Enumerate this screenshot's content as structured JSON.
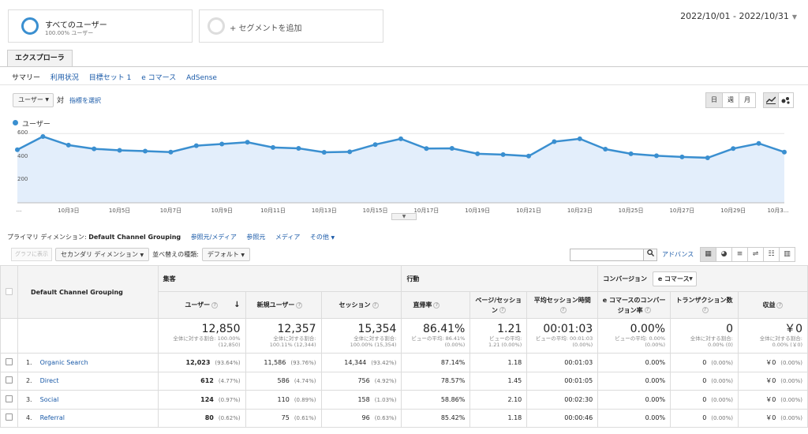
{
  "segments": [
    {
      "title": "すべてのユーザー",
      "sub": "100.00% ユーザー"
    },
    {
      "title": "+ セグメントを追加"
    }
  ],
  "date_range": "2022/10/01 - 2022/10/31",
  "tab": "エクスプローラ",
  "subnav": [
    "サマリー",
    "利用状況",
    "目標セット 1",
    "e コマース",
    "AdSense"
  ],
  "metric_dropdown": "ユーザー",
  "vs_label": "対",
  "select_metric": "指標を選択",
  "period_buttons": [
    "日",
    "週",
    "月"
  ],
  "legend": "ユーザー",
  "chart_data": {
    "type": "line",
    "series": [
      {
        "name": "ユーザー",
        "values": [
          460,
          575,
          500,
          468,
          455,
          448,
          440,
          495,
          510,
          525,
          480,
          472,
          438,
          442,
          505,
          555,
          470,
          472,
          425,
          418,
          405,
          530,
          555,
          465,
          425,
          408,
          398,
          390,
          470,
          515,
          440
        ]
      }
    ],
    "ylim": [
      0,
      650
    ],
    "yticks": [
      "200",
      "400",
      "600"
    ],
    "xticks": [
      {
        "label": "...",
        "day": 1
      },
      {
        "label": "10月3日",
        "day": 3
      },
      {
        "label": "10月5日",
        "day": 5
      },
      {
        "label": "10月7日",
        "day": 7
      },
      {
        "label": "10月9日",
        "day": 9
      },
      {
        "label": "10月11日",
        "day": 11
      },
      {
        "label": "10月13日",
        "day": 13
      },
      {
        "label": "10月15日",
        "day": 15
      },
      {
        "label": "10月17日",
        "day": 17
      },
      {
        "label": "10月19日",
        "day": 19
      },
      {
        "label": "10月21日",
        "day": 21
      },
      {
        "label": "10月23日",
        "day": 23
      },
      {
        "label": "10月25日",
        "day": 25
      },
      {
        "label": "10月27日",
        "day": 27
      },
      {
        "label": "10月29日",
        "day": 29
      },
      {
        "label": "10月3...",
        "day": 31
      }
    ],
    "color": "#3a8fd0",
    "fill": "#e3eefb"
  },
  "dimension": {
    "label": "プライマリ ディメンション:",
    "active": "Default Channel Grouping",
    "options": [
      "参照元/メディア",
      "参照元",
      "メディア",
      "その他"
    ]
  },
  "toolbar": {
    "plot": "グラフに表示",
    "secondary": "セカンダリ ディメンション",
    "sort_label": "並べ替えの種類:",
    "sort_value": "デフォルト",
    "advanced": "アドバンス"
  },
  "table": {
    "dim_header": "Default Channel Grouping",
    "groups": [
      "集客",
      "行動",
      "コンバージョン"
    ],
    "conv_dropdown": "e コマース",
    "columns": [
      "ユーザー",
      "新規ユーザー",
      "セッション",
      "直帰率",
      "ページ/セッション",
      "平均セッション時間",
      "e コマースのコンバージョン率",
      "トランザクション数",
      "収益"
    ],
    "totals": [
      {
        "big": "12,850",
        "small1": "全体に対する割合: 100.00%",
        "small2": "(12,850)"
      },
      {
        "big": "12,357",
        "small1": "全体に対する割合:",
        "small2": "100.11% (12,344)"
      },
      {
        "big": "15,354",
        "small1": "全体に対する割合:",
        "small2": "100.00% (15,354)"
      },
      {
        "big": "86.41%",
        "small1": "ビューの平均: 86.41%",
        "small2": "(0.00%)"
      },
      {
        "big": "1.21",
        "small1": "ビューの平均:",
        "small2": "1.21 (0.00%)"
      },
      {
        "big": "00:01:03",
        "small1": "ビューの平均: 00:01:03",
        "small2": "(0.00%)"
      },
      {
        "big": "0.00%",
        "small1": "ビューの平均: 0.00%",
        "small2": "(0.00%)"
      },
      {
        "big": "0",
        "small1": "全体に対する割合:",
        "small2": "0.00% (0)"
      },
      {
        "big": "￥0",
        "small1": "全体に対する割合:",
        "small2": "0.00% (￥0)"
      }
    ],
    "rows": [
      {
        "idx": "1.",
        "name": "Organic Search",
        "users": "12,023",
        "users_pct": "(93.64%)",
        "new": "11,586",
        "new_pct": "(93.76%)",
        "sess": "14,344",
        "sess_pct": "(93.42%)",
        "bounce": "87.14%",
        "pps": "1.18",
        "dur": "00:01:03",
        "conv": "0.00%",
        "tx": "0",
        "tx_pct": "(0.00%)",
        "rev": "￥0",
        "rev_pct": "(0.00%)"
      },
      {
        "idx": "2.",
        "name": "Direct",
        "users": "612",
        "users_pct": "(4.77%)",
        "new": "586",
        "new_pct": "(4.74%)",
        "sess": "756",
        "sess_pct": "(4.92%)",
        "bounce": "78.57%",
        "pps": "1.45",
        "dur": "00:01:05",
        "conv": "0.00%",
        "tx": "0",
        "tx_pct": "(0.00%)",
        "rev": "￥0",
        "rev_pct": "(0.00%)"
      },
      {
        "idx": "3.",
        "name": "Social",
        "users": "124",
        "users_pct": "(0.97%)",
        "new": "110",
        "new_pct": "(0.89%)",
        "sess": "158",
        "sess_pct": "(1.03%)",
        "bounce": "58.86%",
        "pps": "2.10",
        "dur": "00:02:30",
        "conv": "0.00%",
        "tx": "0",
        "tx_pct": "(0.00%)",
        "rev": "￥0",
        "rev_pct": "(0.00%)"
      },
      {
        "idx": "4.",
        "name": "Referral",
        "users": "80",
        "users_pct": "(0.62%)",
        "new": "75",
        "new_pct": "(0.61%)",
        "sess": "96",
        "sess_pct": "(0.63%)",
        "bounce": "85.42%",
        "pps": "1.18",
        "dur": "00:00:46",
        "conv": "0.00%",
        "tx": "0",
        "tx_pct": "(0.00%)",
        "rev": "￥0",
        "rev_pct": "(0.00%)"
      }
    ]
  }
}
